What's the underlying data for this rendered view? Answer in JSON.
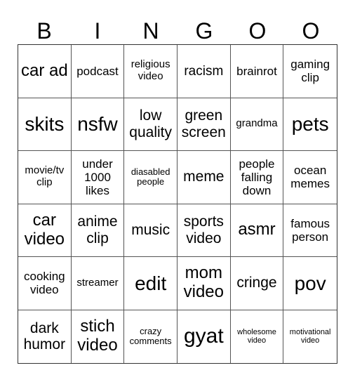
{
  "header": [
    "B",
    "I",
    "N",
    "G",
    "O",
    "O"
  ],
  "cells": [
    "car ad",
    "podcast",
    "religious video",
    "racism",
    "brainrot",
    "gaming clip",
    "skits",
    "nsfw",
    "low quality",
    "green screen",
    "grandma",
    "pets",
    "movie/tv clip",
    "under 1000 likes",
    "diasabled people",
    "meme",
    "people falling down",
    "ocean memes",
    "car video",
    "anime clip",
    "music",
    "sports video",
    "asmr",
    "famous person",
    "cooking video",
    "streamer",
    "edit",
    "mom video",
    "cringe",
    "pov",
    "dark humor",
    "stich video",
    "crazy comments",
    "gyat",
    "wholesome video",
    "motivational video"
  ]
}
